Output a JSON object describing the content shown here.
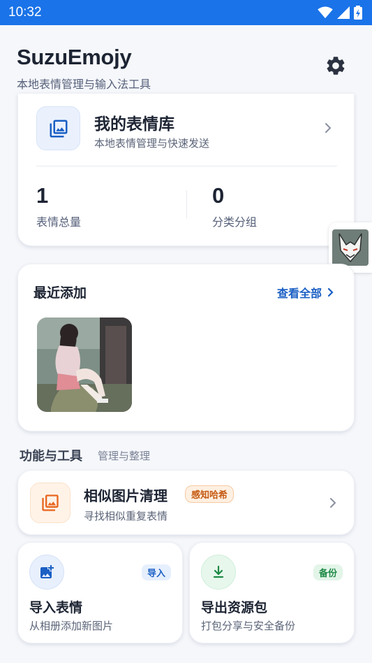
{
  "status_bar": {
    "time": "10:32"
  },
  "header": {
    "title": "SuzuEmojy",
    "subtitle": "本地表情管理与输入法工具",
    "settings_icon": "gear-icon"
  },
  "library": {
    "title": "我的表情库",
    "description": "本地表情管理与快速发送",
    "stats": [
      {
        "value": "1",
        "label": "表情总量"
      },
      {
        "value": "0",
        "label": "分类分组"
      }
    ]
  },
  "recent": {
    "title": "最近添加",
    "view_all": "查看全部"
  },
  "tools_section": {
    "title": "功能与工具",
    "subtitle": "管理与整理"
  },
  "similar_cleanup": {
    "title": "相似图片清理",
    "badge": "感知哈希",
    "description": "寻找相似重复表情"
  },
  "import": {
    "title": "导入表情",
    "badge": "导入",
    "description": "从相册添加新图片"
  },
  "export": {
    "title": "导出资源包",
    "badge": "备份",
    "description": "打包分享与安全备份"
  },
  "colors": {
    "status_bar": "#1a73e8",
    "accent_blue": "#1a5fc4",
    "accent_orange": "#e8661f",
    "accent_green": "#1e8a45"
  }
}
